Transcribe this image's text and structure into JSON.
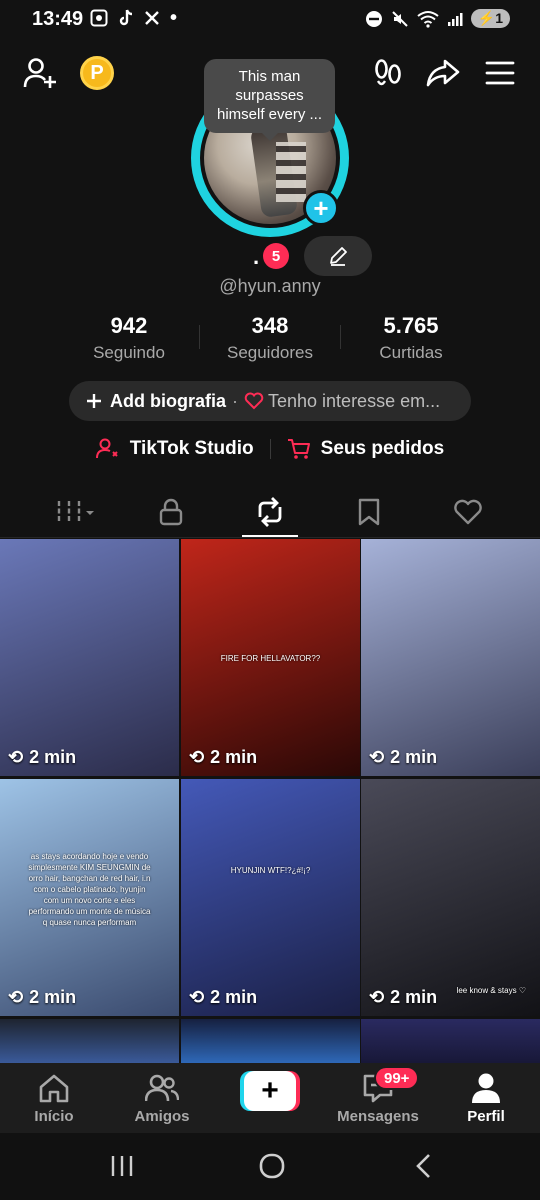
{
  "status_bar": {
    "time": "13:49",
    "left_icons": [
      "screenshot-icon",
      "tiktok-icon",
      "x-icon",
      "dot"
    ],
    "battery": "1"
  },
  "header": {
    "add_friend_icon": "person-add-icon",
    "coin_label": "P",
    "footprints_icon": "footprints-icon",
    "share_icon": "share-icon",
    "menu_icon": "menu-icon"
  },
  "profile": {
    "tooltip": "This man surpasses himself every ...",
    "display_name": ".",
    "name_badge": "5",
    "username": "@hyun.anny"
  },
  "stats": [
    {
      "value": "942",
      "label": "Seguindo"
    },
    {
      "value": "348",
      "label": "Seguidores"
    },
    {
      "value": "5.765",
      "label": "Curtidas"
    }
  ],
  "bio": {
    "add_label": "Add biografia",
    "separator": "·",
    "interest_label": "Tenho interesse em..."
  },
  "links": {
    "studio": "TikTok Studio",
    "orders": "Seus pedidos"
  },
  "tabs": [
    {
      "icon": "grid-icon",
      "active": false
    },
    {
      "icon": "lock-icon",
      "active": false
    },
    {
      "icon": "repost-icon",
      "active": true
    },
    {
      "icon": "bookmark-icon",
      "active": false
    },
    {
      "icon": "heart-icon",
      "active": false
    }
  ],
  "videos": [
    {
      "duration": "2 min",
      "overlay": "",
      "colors": [
        "#6a78b8",
        "#2b2c4a"
      ]
    },
    {
      "duration": "2 min",
      "overlay": "FIRE FOR HELLAVATOR??",
      "colors": [
        "#c0261a",
        "#2a0806"
      ]
    },
    {
      "duration": "2 min",
      "overlay": "",
      "colors": [
        "#a6b2d8",
        "#3b3f5a"
      ]
    },
    {
      "duration": "2 min",
      "overlay": "as stays acordando hoje e vendo simplesmente KIM SEUNGMIN de orro hair, bangchan de red hair, i.n com o cabelo platinado, hyunjin com um novo corte e eles performando um monte de música q quase nunca performam",
      "colors": [
        "#9ec3e6",
        "#3a4a6e"
      ]
    },
    {
      "duration": "2 min",
      "overlay": "HYUNJIN WTF!?¿#!¡?",
      "colors": [
        "#4459b8",
        "#1a1f45"
      ]
    },
    {
      "duration": "2 min",
      "overlay": "lee know & stays ♡",
      "colors": [
        "#4a4a58",
        "#121216"
      ]
    }
  ],
  "bottom_nav": {
    "home": "Início",
    "friends": "Amigos",
    "messages": "Mensagens",
    "messages_badge": "99+",
    "profile": "Perfil"
  }
}
